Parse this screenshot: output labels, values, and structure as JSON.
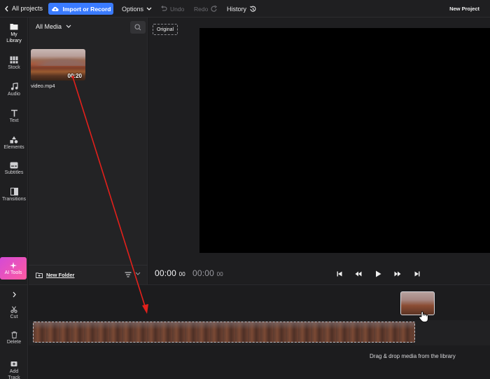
{
  "topbar": {
    "back_label": "All projects",
    "import_label": "Import or Record",
    "options_label": "Options",
    "undo_label": "Undo",
    "redo_label": "Redo",
    "history_label": "History",
    "project_name": "New Project"
  },
  "rail": {
    "items": [
      {
        "label": "My Library",
        "icon": "folder-icon"
      },
      {
        "label": "Stock",
        "icon": "stock-icon"
      },
      {
        "label": "Audio",
        "icon": "music-note-icon"
      },
      {
        "label": "Text",
        "icon": "text-icon"
      },
      {
        "label": "Elements",
        "icon": "shapes-icon"
      },
      {
        "label": "Subtitles",
        "icon": "subtitles-icon"
      },
      {
        "label": "Transitions",
        "icon": "transition-icon"
      }
    ],
    "ai_tools_label": "AI Tools"
  },
  "media": {
    "filter_label": "All Media",
    "items": [
      {
        "name": "video.mp4",
        "duration": "00:20"
      }
    ],
    "new_folder_label": "New Folder"
  },
  "preview": {
    "original_label": "Original",
    "current_time_main": "00:00",
    "current_time_frac": "00",
    "total_time_main": "00:00",
    "total_time_frac": "00"
  },
  "timeline": {
    "tools": [
      {
        "label": "Cut",
        "icon": "scissors-icon"
      },
      {
        "label": "Delete",
        "icon": "trash-icon"
      },
      {
        "label": "Add Track",
        "icon": "add-track-icon"
      }
    ],
    "drop_hint": "Drag & drop media from the library"
  },
  "colors": {
    "accent": "#3a7bff",
    "ai_gradient_start": "#d44ad6",
    "ai_gradient_end": "#ff5aa0",
    "annotation_arrow": "#e3201b"
  }
}
